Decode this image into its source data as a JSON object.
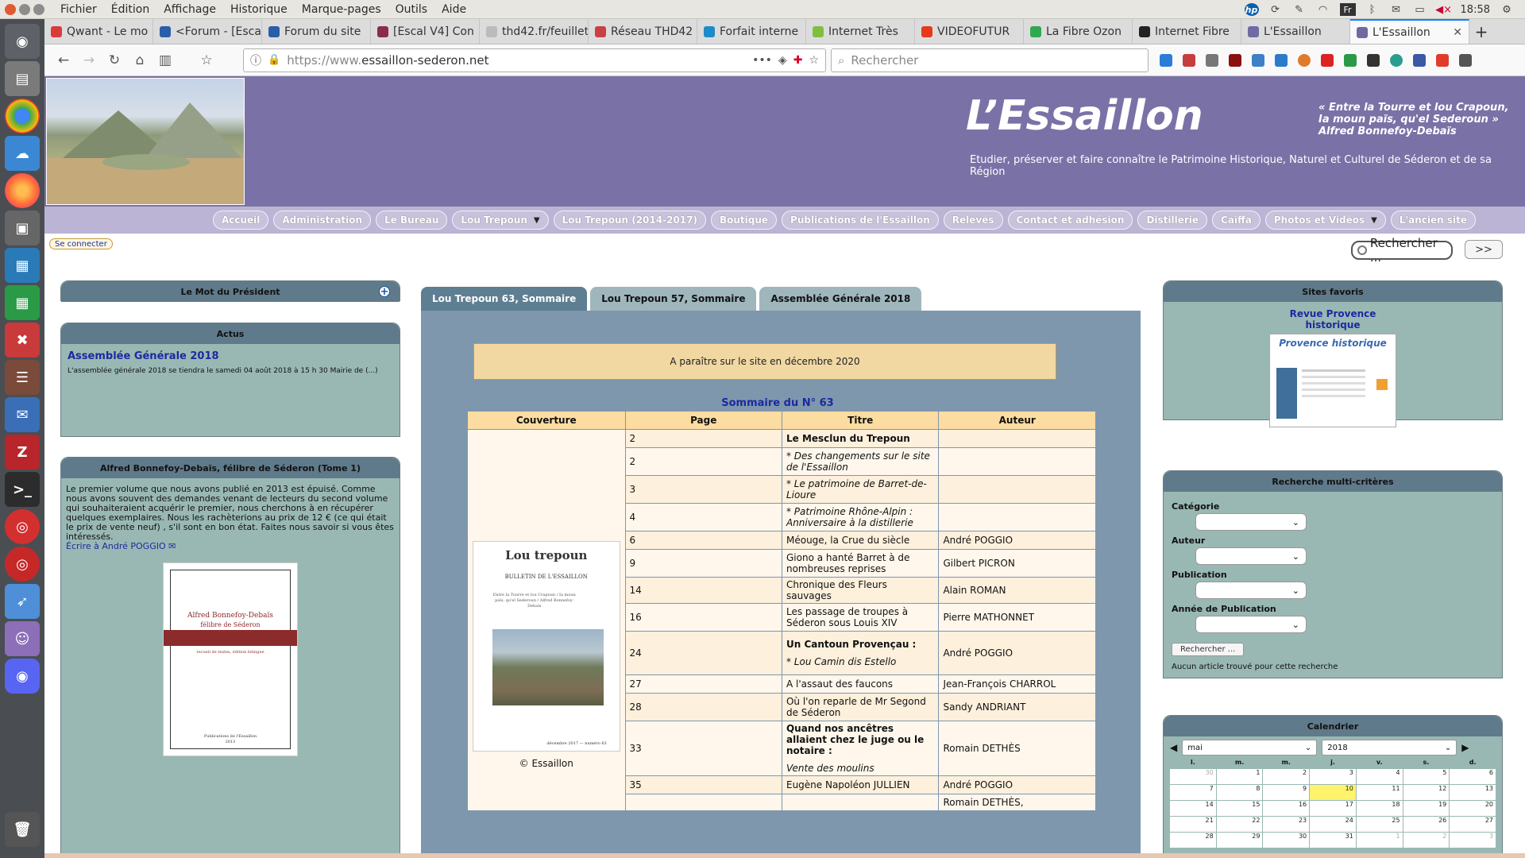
{
  "system": {
    "menu": [
      "Fichier",
      "Édition",
      "Affichage",
      "Historique",
      "Marque-pages",
      "Outils",
      "Aide"
    ],
    "keyboard": "Fr",
    "clock": "18:58",
    "hp_label": "hp"
  },
  "browser": {
    "tabs": [
      {
        "label": "Qwant - Le mo",
        "color": "#d93a3a"
      },
      {
        "label": "<Forum - [Esca",
        "color": "#2b5ea8"
      },
      {
        "label": "Forum du site",
        "color": "#2b5ea8"
      },
      {
        "label": "[Escal V4] Con",
        "color": "#8c2b4a"
      },
      {
        "label": "thd42.fr/feuillet/",
        "color": "#bbbbbb"
      },
      {
        "label": "Réseau THD42",
        "color": "#c94040"
      },
      {
        "label": "Forfait interne",
        "color": "#1c8acb"
      },
      {
        "label": "Internet Très",
        "color": "#7fbf3f"
      },
      {
        "label": "VIDEOFUTUR",
        "color": "#e5391a"
      },
      {
        "label": "La Fibre Ozon",
        "color": "#2fa84f"
      },
      {
        "label": "Internet Fibre",
        "color": "#222222"
      },
      {
        "label": "L'Essaillon",
        "color": "#6f6aa2"
      },
      {
        "label": "L'Essaillon",
        "color": "#6f6aa2",
        "active": true
      }
    ],
    "url_proto": "https://www.",
    "url_host": "essaillon-sederon.net",
    "search_placeholder": "Rechercher"
  },
  "site": {
    "title": "L’Essaillon",
    "quote_line1": "« Entre la Tourre et lou Crapoun,",
    "quote_line2": "Ia moun païs, qu'el Sederoun »",
    "quote_line3": "Alfred Bonnefoy-Debaïs",
    "tagline": "Etudier, préserver et faire connaître le Patrimoine Historique, Naturel et Culturel de Séderon et de sa Région",
    "menu": [
      {
        "label": "Accueil"
      },
      {
        "label": "Administration"
      },
      {
        "label": "Le Bureau"
      },
      {
        "label": "Lou Trepoun",
        "caret": "▼"
      },
      {
        "label": "Lou Trepoun (2014-2017)"
      },
      {
        "label": "Boutique"
      },
      {
        "label": "Publications de l'Essaillon"
      },
      {
        "label": "Relevés"
      },
      {
        "label": "Contact et adhésion"
      },
      {
        "label": "Distillerie"
      },
      {
        "label": "Caïffa"
      },
      {
        "label": "Photos et Vidéos",
        "caret": "▼"
      },
      {
        "label": "L'ancien site"
      }
    ],
    "login": "Se connecter",
    "site_search": "Rechercher ...",
    "go": ">>"
  },
  "left": {
    "president": {
      "title": "Le Mot du Président"
    },
    "actus": {
      "title": "Actus",
      "item_title": "Assemblée Générale 2018",
      "item_text": "L'assemblée générale 2018 se tiendra le samedi 04 août 2018 à 15 h 30 Mairie de (...)"
    },
    "book": {
      "title": "Alfred Bonnefoy-Debaïs, félibre de Séderon (Tome 1)",
      "text": "Le premier volume que nous avons publié en 2013 est épuisé. Comme nous avons souvent des demandes venant de lecteurs du second volume qui souhaiteraient acquérir le premier, nous cherchons à en récupérer quelques exemplaires. Nous les rachèterions au prix de 12 € (ce qui était le prix de vente neuf) , s'il sont en bon état. Faites nous savoir si vous êtes intéressés.",
      "mail_link": "Écrire à André POGGIO",
      "cover_title": "Alfred Bonnefoy-Debaïs",
      "cover_sub": "félibre de Séderon",
      "cover_band": "recueil de textes, édition bilingue",
      "cover_pub": "Publications de l'Essaillon",
      "cover_year": "2013"
    }
  },
  "center": {
    "tabs": [
      {
        "label": "Lou Trepoun 63, Sommaire",
        "active": true
      },
      {
        "label": "Lou Trepoun 57, Sommaire"
      },
      {
        "label": "Assemblée Générale 2018"
      }
    ],
    "banner": "A paraître sur le site en décembre 2020",
    "sommaire_title": "Sommaire du N° 63",
    "columns": [
      "Couverture",
      "Page",
      "Titre",
      "Auteur"
    ],
    "cover": {
      "title": "Lou trepoun",
      "subtitle": "BULLETIN DE L'ESSAILLON",
      "lines": "Entre la Tourre et lou Crapoun / Ia moun païs, qu'el Sederoun / Alfred Bonnefoy-Debaïs",
      "footer": "décembre 2017 — numéro 63",
      "copyright": "© Essaillon"
    },
    "rows": [
      {
        "page": "2",
        "title": "Le Mesclun du Trepoun",
        "style": "bd",
        "author": ""
      },
      {
        "page": "2",
        "title": "* Des changements sur le site de l'Essaillon",
        "style": "it",
        "author": ""
      },
      {
        "page": "3",
        "title": "* Le patrimoine de Barret-de-Lioure",
        "style": "it",
        "author": ""
      },
      {
        "page": "4",
        "title": "* Patrimoine Rhône-Alpin : Anniversaire à la distillerie",
        "style": "it",
        "author": ""
      },
      {
        "page": "6",
        "title": "Méouge, la Crue du siècle",
        "style": "",
        "author": "André POGGIO"
      },
      {
        "page": "9",
        "title": "Giono a hanté Barret à de nombreuses reprises",
        "style": "",
        "author": "Gilbert PICRON"
      },
      {
        "page": "14",
        "title": "Chronique des Fleurs sauvages",
        "style": "",
        "author": "Alain ROMAN"
      },
      {
        "page": "16",
        "title": "Les passage de troupes à Séderon sous Louis XIV",
        "style": "",
        "author": "Pierre MATHONNET"
      },
      {
        "page": "24",
        "title": "Un Cantoun Provençau :",
        "title2": "* Lou Camin dis Estello",
        "style": "bd",
        "author": "André POGGIO"
      },
      {
        "page": "27",
        "title": "A l'assaut des faucons",
        "style": "",
        "author": "Jean-François CHARROL"
      },
      {
        "page": "28",
        "title": "Où l'on reparle de Mr Segond de Séderon",
        "style": "",
        "author": "Sandy ANDRIANT"
      },
      {
        "page": "33",
        "title": "Quand nos ancêtres allaient chez le juge ou le notaire :",
        "title2": "Vente des moulins",
        "style": "bd",
        "author": "Romain DETHÈS"
      },
      {
        "page": "35",
        "title": "Eugène Napoléon JULLIEN",
        "style": "",
        "author": "André POGGIO"
      },
      {
        "page": "",
        "title": "",
        "style": "",
        "author": "Romain DETHÈS,"
      }
    ]
  },
  "right": {
    "favs": {
      "title": "Sites favoris",
      "link": "Revue Provence historique",
      "thumb_title": "Provence historique"
    },
    "search": {
      "title": "Recherche multi-critères",
      "labels": [
        "Catégorie",
        "Auteur",
        "Publication",
        "Année de Publication"
      ],
      "button": "Rechercher ...",
      "result": "Aucun article trouvé pour cette recherche"
    },
    "calendar": {
      "title": "Calendrier",
      "month": "mai",
      "year": "2018",
      "days": [
        "l.",
        "m.",
        "m.",
        "j.",
        "v.",
        "s.",
        "d."
      ],
      "cells": [
        "30",
        "1",
        "2",
        "3",
        "4",
        "5",
        "6",
        "7",
        "8",
        "9",
        "10",
        "11",
        "12",
        "13",
        "14",
        "15",
        "16",
        "17",
        "18",
        "19",
        "20",
        "21",
        "22",
        "23",
        "24",
        "25",
        "26",
        "27",
        "28",
        "29",
        "30",
        "31",
        "1",
        "2",
        "3"
      ],
      "today": "10"
    }
  }
}
